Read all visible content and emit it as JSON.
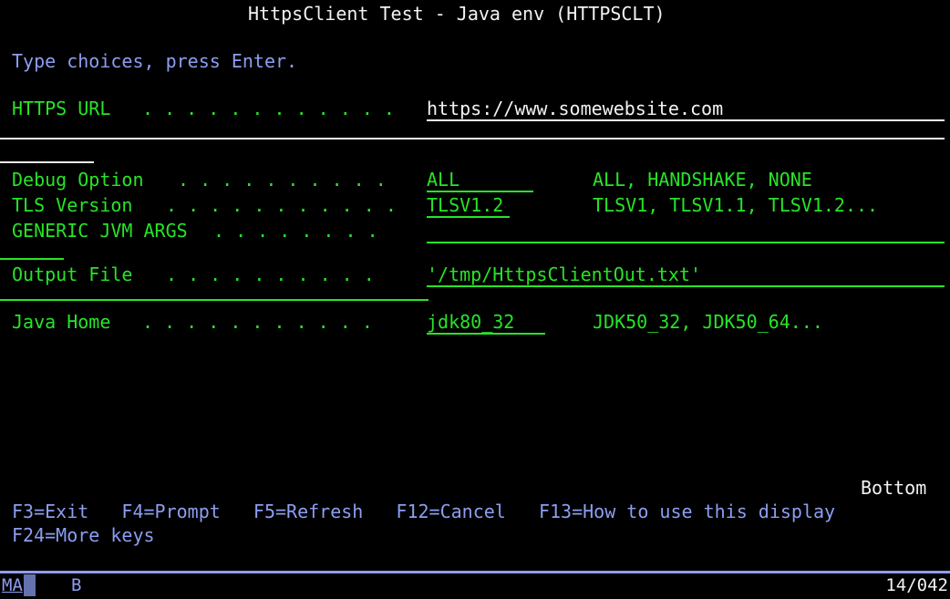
{
  "screen": {
    "title": "HttpsClient Test - Java env (HTTPSCLT)",
    "instruction": "Type choices, press Enter.",
    "more_indicator": "Bottom"
  },
  "colors": {
    "label_green": "#27e427",
    "text_white": "#f2f2f2",
    "text_blue": "#8c9ef0",
    "background": "#000000"
  },
  "fields": [
    {
      "label": "HTTPS URL",
      "dots": ". . . . . . . . . . . .",
      "value": "https://www.somewebsite.com",
      "hint": "",
      "color": "white"
    },
    {
      "label": "Debug Option",
      "dots": ". . . . . . . . . .",
      "value": "ALL",
      "hint": "ALL, HANDSHAKE, NONE",
      "color": "green"
    },
    {
      "label": "TLS Version",
      "dots": ". . . . . . . . . . .",
      "value": "TLSV1.2",
      "hint": "TLSV1, TLSV1.1, TLSV1.2...",
      "color": "green"
    },
    {
      "label": "GENERIC JVM ARGS",
      "dots": ". . . . . . . .",
      "value": "",
      "hint": "",
      "color": "green"
    },
    {
      "label": "Output File",
      "dots": ". . . . . . . . . .",
      "value": "'/tmp/HttpsClientOut.txt'",
      "hint": "",
      "color": "green"
    },
    {
      "label": "Java Home",
      "dots": ". . . . . . . . . . .",
      "value": "jdk80_32",
      "hint": "JDK50_32, JDK50_64...",
      "color": "green"
    }
  ],
  "function_keys": {
    "line1": "F3=Exit   F4=Prompt   F5=Refresh   F12=Cancel   F13=How to use this display",
    "line2": "F24=More keys",
    "keys": [
      "F3=Exit",
      "F4=Prompt",
      "F5=Refresh",
      "F12=Cancel",
      "F13=How to use this display",
      "F24=More keys"
    ]
  },
  "status_bar": {
    "system_indicator": "MA",
    "keyboard_indicator": "B",
    "cursor_position": "14/042"
  }
}
